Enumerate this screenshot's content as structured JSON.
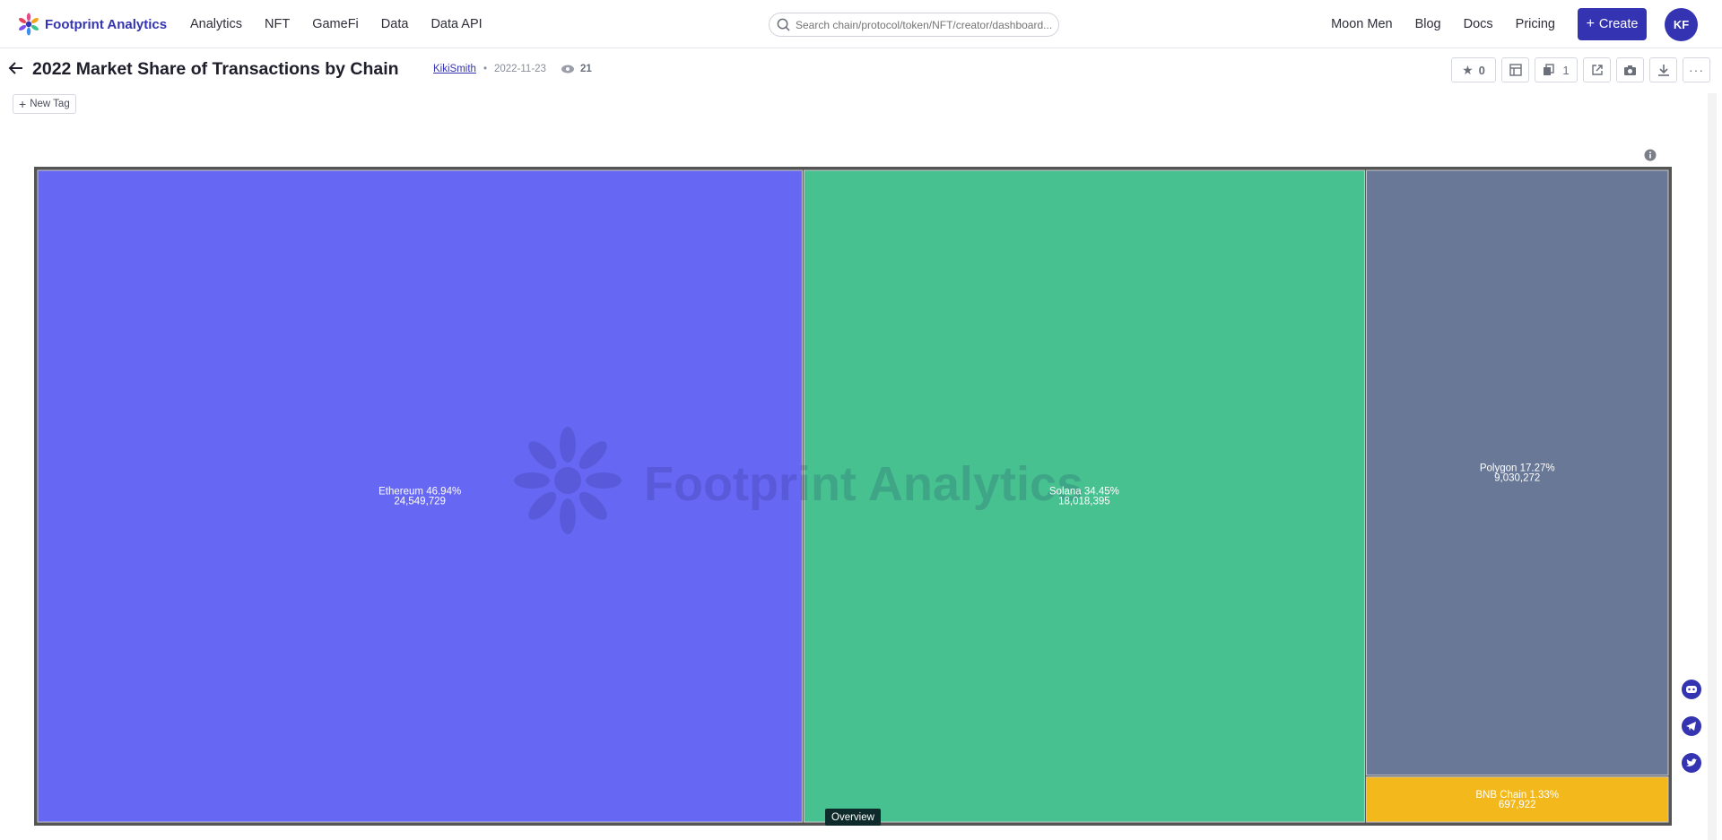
{
  "brand": {
    "name": "Footprint Analytics",
    "accent": "#3434b2"
  },
  "nav": [
    "Analytics",
    "NFT",
    "GameFi",
    "Data",
    "Data API"
  ],
  "search": {
    "placeholder": "Search chain/protocol/token/NFT/creator/dashboard..."
  },
  "right_nav": [
    "Moon Men",
    "Blog",
    "Docs",
    "Pricing"
  ],
  "create_label": "Create",
  "avatar_initials": "KF",
  "page": {
    "title": "2022 Market Share of Transactions by Chain",
    "author": "KikiSmith",
    "date": "2022-11-23",
    "views": "21",
    "star_count": "0",
    "copy_count": "1",
    "new_tag_label": "New Tag"
  },
  "overview_label": "Overview",
  "watermark": "Footprint Analytics",
  "chart_data": {
    "type": "treemap",
    "title": "",
    "items": [
      {
        "name": "Ethereum",
        "percent": "46.94%",
        "value": 24549729,
        "value_label": "24,549,729",
        "color": "#6667f2"
      },
      {
        "name": "Solana",
        "percent": "34.45%",
        "value": 18018395,
        "value_label": "18,018,395",
        "color": "#47c18f"
      },
      {
        "name": "Polygon",
        "percent": "17.27%",
        "value": 9030272,
        "value_label": "9,030,272",
        "color": "#687896"
      },
      {
        "name": "BNB Chain",
        "percent": "1.33%",
        "value": 697922,
        "value_label": "697,922",
        "color": "#f3b91c"
      }
    ],
    "label_lines": [
      "Ethereum 46.94%",
      "Solana 34.45%",
      "Polygon 17.27%",
      "BNB Chain 1.33%"
    ]
  }
}
